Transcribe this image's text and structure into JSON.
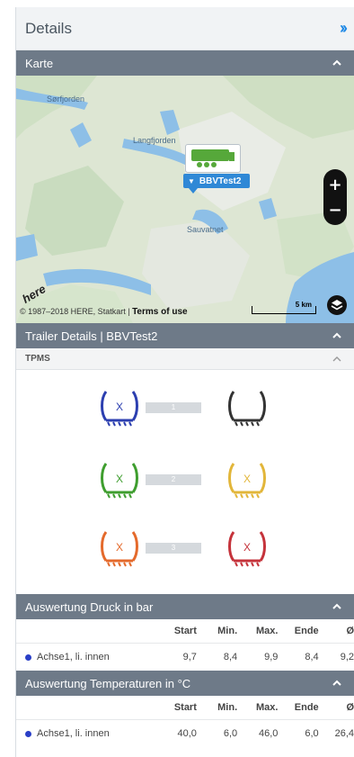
{
  "header": {
    "title": "Details",
    "collapse_icon": "double-chevron-right-icon"
  },
  "map_section": {
    "title": "Karte",
    "places": [
      "Sørfjorden",
      "Langfjorden",
      "Sauvatnet"
    ],
    "vehicle_label": "BBVTest2",
    "copyright": "© 1987–2018 HERE, Statkart |",
    "terms": "Terms of use",
    "scale": "5 km",
    "logo": "here",
    "zoom_in": "+",
    "zoom_out": "−"
  },
  "trailer_section": {
    "title": "Trailer Details | BBVTest2",
    "tpms_title": "TPMS",
    "axles": [
      {
        "num": "1",
        "left": {
          "mark": "X",
          "color": "#2c3fb0"
        },
        "right": {
          "mark": "",
          "color": "#333333"
        }
      },
      {
        "num": "2",
        "left": {
          "mark": "X",
          "color": "#3f9e2f"
        },
        "right": {
          "mark": "X",
          "color": "#e2b63a"
        }
      },
      {
        "num": "3",
        "left": {
          "mark": "X",
          "color": "#e46a2c"
        },
        "right": {
          "mark": "X",
          "color": "#c5333b"
        }
      }
    ]
  },
  "pressure": {
    "title": "Auswertung Druck in bar",
    "columns": [
      "Start",
      "Min.",
      "Max.",
      "Ende",
      "Ø"
    ],
    "rows": [
      {
        "label": "Achse1, li. innen",
        "values": [
          "9,7",
          "8,4",
          "9,9",
          "8,4",
          "9,2"
        ]
      }
    ]
  },
  "temperature": {
    "title": "Auswertung Temperaturen in °C",
    "columns": [
      "Start",
      "Min.",
      "Max.",
      "Ende",
      "Ø"
    ],
    "rows": [
      {
        "label": "Achse1, li. innen",
        "values": [
          "40,0",
          "6,0",
          "46,0",
          "6,0",
          "26,4"
        ]
      }
    ]
  }
}
